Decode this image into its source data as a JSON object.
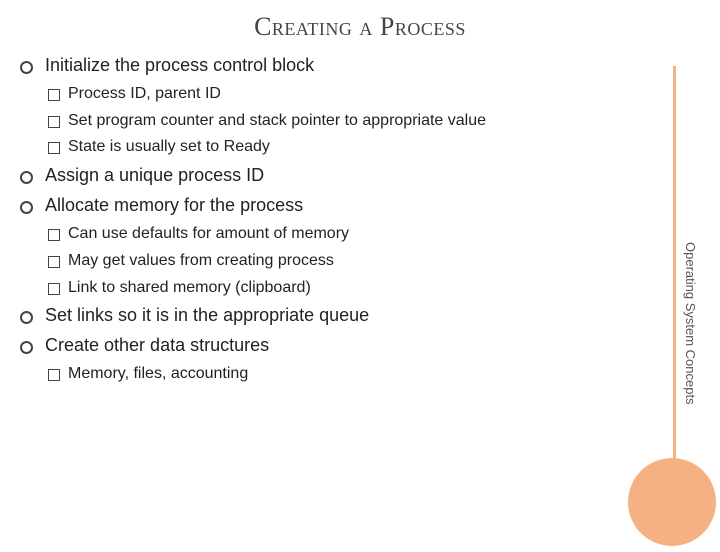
{
  "title": "Creating a Process",
  "side_label": "Operating System Concepts",
  "items": [
    {
      "level": 1,
      "text": "Initialize the process control block"
    },
    {
      "level": 2,
      "text": "Process ID, parent ID"
    },
    {
      "level": 2,
      "text": "Set program counter and stack pointer to appropriate value"
    },
    {
      "level": 2,
      "text": "State is usually set to Ready"
    },
    {
      "level": 1,
      "text": "Assign a unique process ID"
    },
    {
      "level": 1,
      "text": "Allocate memory for the process"
    },
    {
      "level": 2,
      "text": "Can use defaults for amount of memory"
    },
    {
      "level": 2,
      "text": "May get values from creating process"
    },
    {
      "level": 2,
      "text": "Link to shared memory (clipboard)"
    },
    {
      "level": 1,
      "text": "Set links so it is in the appropriate queue"
    },
    {
      "level": 1,
      "text": "Create other data structures"
    },
    {
      "level": 2,
      "text": "Memory, files, accounting"
    }
  ]
}
